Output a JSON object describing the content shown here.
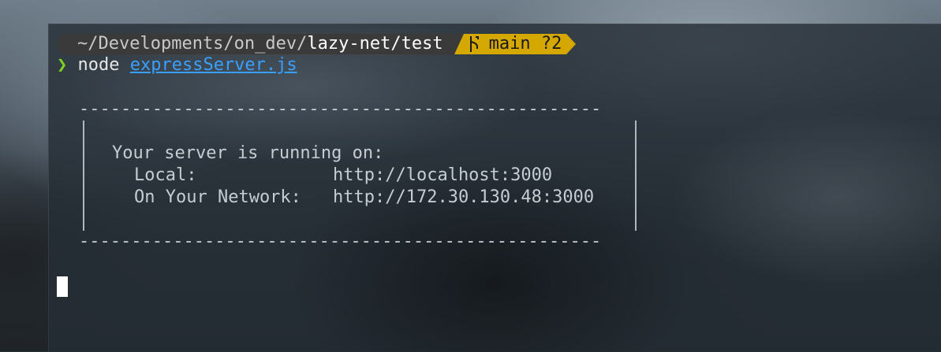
{
  "prompt": {
    "path_dim": "~/Developments/on_dev/",
    "path_bright": "lazy-net/test",
    "git_icon": "git-branch-icon",
    "git_branch": "main ?2"
  },
  "command": {
    "chevron": "❯",
    "program": "node",
    "file": "expressServer.js"
  },
  "output": {
    "dashes_top": "--------------------------------------------------",
    "dashes_bottom": "--------------------------------------------------",
    "heading": "Your server is running on:",
    "local_label": "Local:",
    "local_url": "http://localhost:3000",
    "network_label": "On Your Network:",
    "network_url": "http://172.30.130.48:3000"
  },
  "colors": {
    "chevron": "#7ed321",
    "link": "#3aa0ff",
    "git_segment": "#d4a800",
    "path_segment": "#3a3a3a"
  }
}
